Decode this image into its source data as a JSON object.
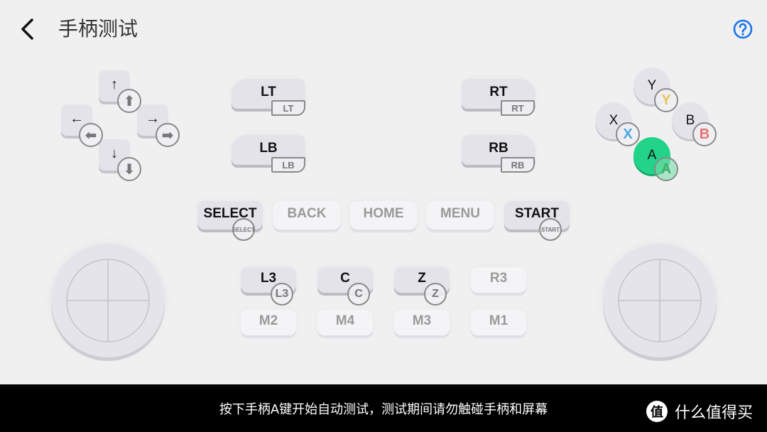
{
  "header": {
    "title": "手柄测试",
    "back_icon": "chevron-left-icon",
    "help_icon": "question-circle-icon",
    "accent_color": "#1a73e8"
  },
  "dpad": {
    "up": {
      "key": "↑",
      "badge": "⬆"
    },
    "left": {
      "key": "←",
      "badge": "⬅"
    },
    "right": {
      "key": "→",
      "badge": "➡"
    },
    "down": {
      "key": "↓",
      "badge": "⬇"
    }
  },
  "triggers": {
    "lt": {
      "label": "LT",
      "tag": "LT"
    },
    "lb": {
      "label": "LB",
      "tag": "LB"
    },
    "rt": {
      "label": "RT",
      "tag": "RT"
    },
    "rb": {
      "label": "RB",
      "tag": "RB"
    }
  },
  "face_buttons": {
    "y": {
      "label": "Y",
      "badge": "Y",
      "color": "#e8c75a"
    },
    "x": {
      "label": "X",
      "badge": "X",
      "color": "#4aa8e0"
    },
    "b": {
      "label": "B",
      "badge": "B",
      "color": "#e87070"
    },
    "a": {
      "label": "A",
      "badge": "A",
      "color": "#3fae6a",
      "state": "pressed",
      "pressed_color": "#23d38a"
    }
  },
  "middle_row": [
    {
      "label": "SELECT",
      "badge": "SELECT",
      "active": true
    },
    {
      "label": "BACK",
      "active": false
    },
    {
      "label": "HOME",
      "active": false
    },
    {
      "label": "MENU",
      "active": false
    },
    {
      "label": "START",
      "badge": "START",
      "active": true
    }
  ],
  "extra_row1": [
    {
      "label": "L3",
      "badge": "L3",
      "active": true
    },
    {
      "label": "C",
      "badge": "C",
      "active": true
    },
    {
      "label": "Z",
      "badge": "Z",
      "active": true
    },
    {
      "label": "R3",
      "active": false
    }
  ],
  "extra_row2": [
    {
      "label": "M2",
      "active": false
    },
    {
      "label": "M4",
      "active": false
    },
    {
      "label": "M3",
      "active": false
    },
    {
      "label": "M1",
      "active": false
    }
  ],
  "footer": {
    "instruction": "按下手柄A键开始自动测试，测试期间请勿触碰手柄和屏幕",
    "watermark_icon": "值",
    "watermark_text": "什么值得买"
  }
}
